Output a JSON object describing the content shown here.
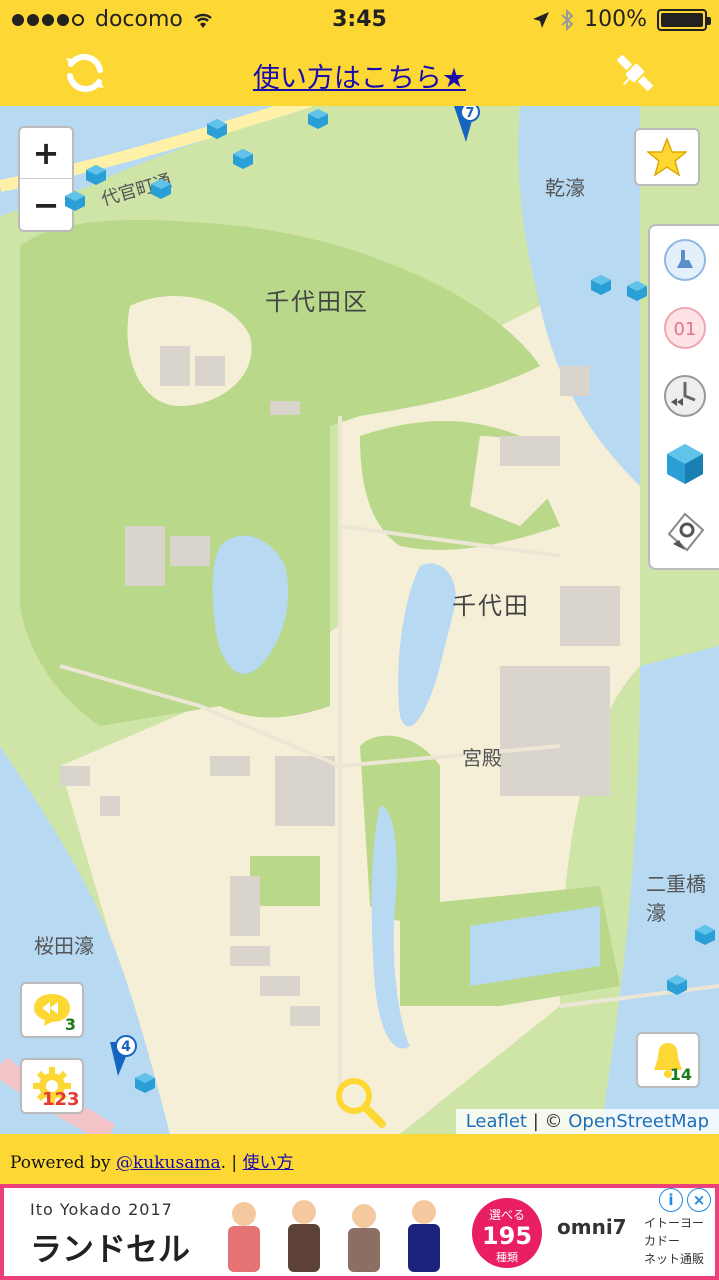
{
  "status_bar": {
    "carrier": "docomo",
    "time": "3:45",
    "battery": "100%"
  },
  "header": {
    "help_link": "使い方はこちら★",
    "refresh_icon": "refresh-icon",
    "satellite_icon": "satellite-icon"
  },
  "map": {
    "zoom_in": "+",
    "zoom_out": "−",
    "labels": {
      "daikancho": "代官町通",
      "inui": "乾濠",
      "chiyoda_ku": "千代田区",
      "chiyoda": "千代田",
      "kyuden": "宮殿",
      "nijubashi": "二重橋濠",
      "sakurada": "桜田濠"
    },
    "pins": [
      "7",
      "4"
    ],
    "side_panel": [
      "pokeball-gym-icon",
      "pokestop-01-icon",
      "history-icon",
      "cube-icon",
      "pokeball-icon"
    ],
    "favorites_icon": "star-icon",
    "rewind_count": "3",
    "settings_count": "123",
    "bell_count": "14",
    "attribution": {
      "leaflet": "Leaflet",
      "sep": " | © ",
      "osm": "OpenStreetMap"
    },
    "colors": {
      "park": "#cfe5a8",
      "water": "#b7d9f2",
      "land": "#f6efd8",
      "accent": "#fdd835"
    }
  },
  "footer": {
    "prefix": "Powered by ",
    "author": "@kukusama",
    "sep": ". | ",
    "howto": "使い方"
  },
  "ad": {
    "brand": "Ito Yokado 2017",
    "product": "ランドセル",
    "badge_top": "選べる",
    "badge_num": "195",
    "badge_bottom": "種類",
    "omni": "omni7",
    "store_line1": "イトーヨーカドー",
    "store_line2": "ネット通販"
  }
}
